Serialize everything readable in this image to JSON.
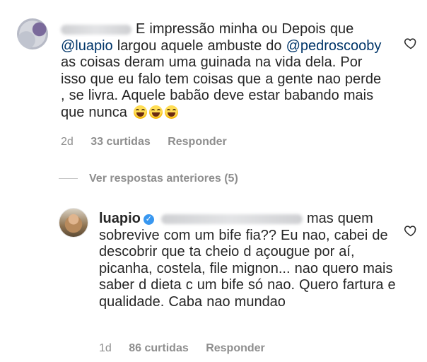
{
  "comments": [
    {
      "text_line1": "E impressão minha ou Depois que",
      "mention1": "@luapio",
      "text_line2": " largou aquele ambuste do",
      "mention2": "@pedroscooby",
      "text_rest": " as coisas deram uma guinada na vida dela. Por isso que eu falo tem coisas que a gente nao perde , se livra. Aquele babão deve estar babando mais que nunca",
      "emoji": "face-with-tears-of-joy-icon",
      "time": "2d",
      "likes": "33 curtidas",
      "reply": "Responder"
    },
    {
      "username": "luapio",
      "text": "mas quem sobrevive com um bife fia?? Eu nao, cabei de descobrir que ta cheio d açougue por aí, picanha, costela, file mignon... nao quero mais saber d dieta c um bife só nao. Quero fartura e qualidade. Caba nao mundao",
      "time": "1d",
      "likes": "86 curtidas",
      "reply": "Responder"
    }
  ],
  "view_replies": "Ver respostas anteriores (5)",
  "colors": {
    "text": "#262626",
    "secondary": "#8e8e8e",
    "mention": "#003569",
    "verified": "#3897f0"
  }
}
